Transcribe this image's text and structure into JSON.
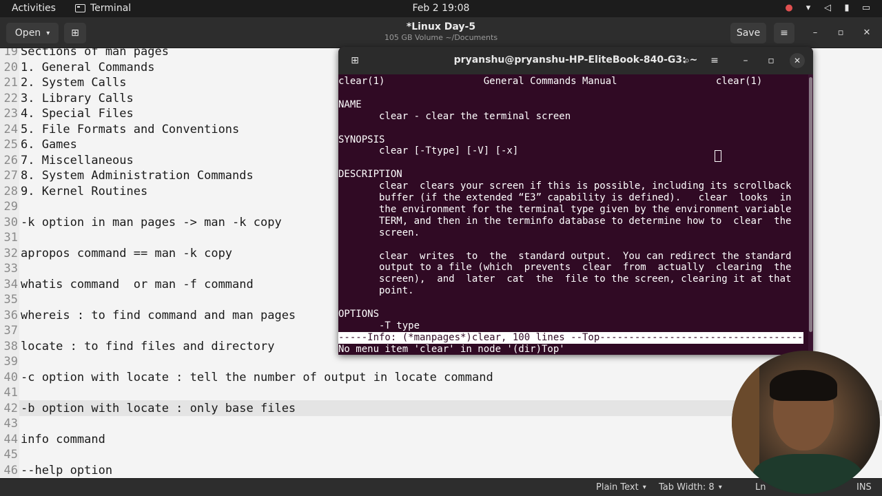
{
  "topbar": {
    "activities": "Activities",
    "app_name": "Terminal",
    "clock": "Feb 2  19:08",
    "tray_icons": [
      "bug-report-icon",
      "wifi-icon",
      "volume-muted-icon",
      "microphone-icon",
      "battery-icon"
    ]
  },
  "editor_header": {
    "open_label": "Open",
    "title": "*Linux Day-5",
    "subtitle": "105 GB Volume ~/Documents",
    "save_label": "Save"
  },
  "editor": {
    "lines": [
      {
        "num": "19",
        "text": "Sections of man pages"
      },
      {
        "num": "20",
        "text": "1. General Commands"
      },
      {
        "num": "21",
        "text": "2. System Calls"
      },
      {
        "num": "22",
        "text": "3. Library Calls"
      },
      {
        "num": "23",
        "text": "4. Special Files"
      },
      {
        "num": "24",
        "text": "5. File Formats and Conventions"
      },
      {
        "num": "25",
        "text": "6. Games"
      },
      {
        "num": "26",
        "text": "7. Miscellaneous"
      },
      {
        "num": "27",
        "text": "8. System Administration Commands"
      },
      {
        "num": "28",
        "text": "9. Kernel Routines"
      },
      {
        "num": "29",
        "text": ""
      },
      {
        "num": "30",
        "text": "-k option in man pages -> man -k copy"
      },
      {
        "num": "31",
        "text": ""
      },
      {
        "num": "32",
        "text": "apropos command == man -k copy"
      },
      {
        "num": "33",
        "text": ""
      },
      {
        "num": "34",
        "text": "whatis command  or man -f command"
      },
      {
        "num": "35",
        "text": ""
      },
      {
        "num": "36",
        "text": "whereis : to find command and man pages"
      },
      {
        "num": "37",
        "text": ""
      },
      {
        "num": "38",
        "text": "locate : to find files and directory"
      },
      {
        "num": "39",
        "text": ""
      },
      {
        "num": "40",
        "text": "-c option with locate : tell the number of output in locate command"
      },
      {
        "num": "41",
        "text": ""
      },
      {
        "num": "42",
        "text": "-b option with locate : only base files"
      },
      {
        "num": "43",
        "text": ""
      },
      {
        "num": "44",
        "text": "info command"
      },
      {
        "num": "45",
        "text": ""
      },
      {
        "num": "46",
        "text": "--help option"
      }
    ]
  },
  "statusbar": {
    "language": "Plain Text",
    "tab_width": "Tab Width: 8",
    "position": "Ln",
    "mode": "INS"
  },
  "terminal": {
    "title": "pryanshu@pryanshu-HP-EliteBook-840-G3: ~",
    "lines": [
      "clear(1)                 General Commands Manual                 clear(1)",
      "",
      "NAME",
      "       clear - clear the terminal screen",
      "",
      "SYNOPSIS",
      "       clear [-Ttype] [-V] [-x]",
      "",
      "DESCRIPTION",
      "       clear  clears your screen if this is possible, including its scrollback",
      "       buffer (if the extended “E3” capability is defined).   clear  looks  in",
      "       the environment for the terminal type given by the environment variable",
      "       TERM, and then in the terminfo database to determine how to  clear  the",
      "       screen.",
      "",
      "       clear  writes  to  the  standard output.  You can redirect the standard",
      "       output to a file (which  prevents  clear  from  actually  clearing  the",
      "       screen),  and  later  cat  the  file to the screen, clearing it at that",
      "       point.",
      "",
      "OPTIONS",
      "       -T type"
    ],
    "mode_line": "-----Info: (*manpages*)clear, 100 lines --Top--------------------------------------",
    "echo_line": "No menu item 'clear' in node '(dir)Top'"
  }
}
